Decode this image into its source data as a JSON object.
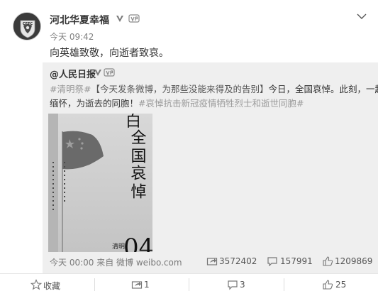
{
  "post": {
    "author": "河北华夏幸福",
    "time": "今天 09:42",
    "text": "向英雄致敬，向逝者致哀。",
    "avatar_label": "CFFC"
  },
  "repost": {
    "author": "@人民日报",
    "tag1": "#清明祭#",
    "link_text": "【今天发条微博，为那些没能来得及的告别】",
    "line1_tail": "今日，全国哀悼。此刻，一起",
    "line2_head": "缅怀，为逝去的同胞！",
    "tag2": "#哀悼抗击新冠疫情牺牲烈士和逝世同胞#",
    "time_source": "今天 00:00 来自 微博 weibo.com",
    "forwards": "3572402",
    "comments": "157991",
    "likes": "1209869"
  },
  "photo": {
    "big_char": "白",
    "line1": "全国",
    "line2": "哀悼",
    "date_small": "清明",
    "date_num": "04"
  },
  "actions": {
    "favorite": "收藏",
    "forward": "1",
    "comment": "3",
    "like": "25"
  },
  "icons": {
    "verified": "verified-v-icon",
    "vip": "vip-badge-icon",
    "menu": "chevron-down-icon",
    "forward": "forward-icon",
    "comment": "comment-icon",
    "like": "thumbs-up-icon",
    "favorite": "star-icon"
  },
  "colors": {
    "repost_bg": "#efefef",
    "text": "#333333",
    "muted": "#808080"
  }
}
